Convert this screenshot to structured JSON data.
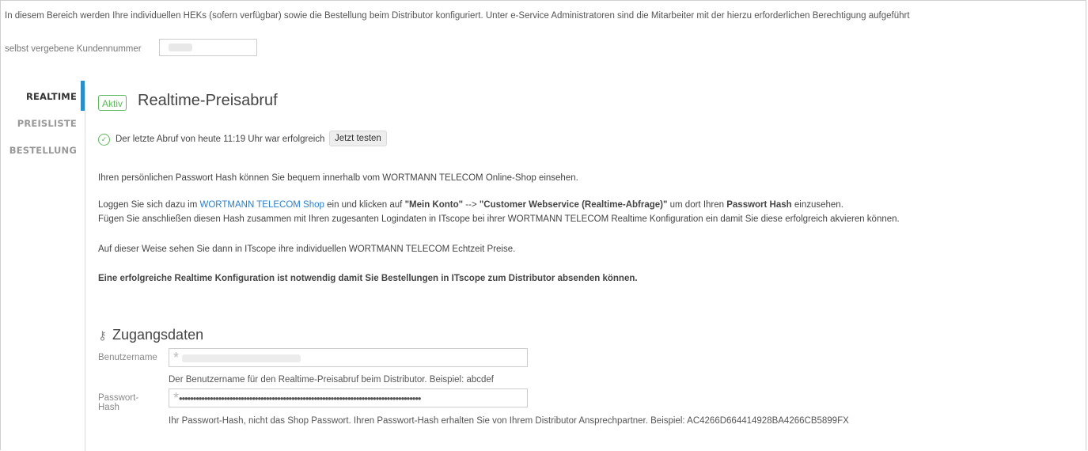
{
  "intro_text": "In diesem Bereich werden Ihre individuellen HEKs (sofern verfügbar) sowie die Bestellung beim Distributor konfiguriert. Unter e-Service Administratoren sind die Mitarbeiter mit der hierzu erforderlichen Berechtigung aufgeführt",
  "customer_number": {
    "label": "selbst vergebene Kundennummer",
    "value": ""
  },
  "nav": {
    "items": [
      {
        "label": "REALTIME",
        "active": true
      },
      {
        "label": "PREISLISTE",
        "active": false
      },
      {
        "label": "BESTELLUNG",
        "active": false
      }
    ],
    "accent_color": "#2a8fc9"
  },
  "realtime": {
    "badge": "Aktiv",
    "title": "Realtime-Preisabruf",
    "status_icon": "check-circle-icon",
    "status_text": "Der letzte Abruf von heute 11:19 Uhr war erfolgreich",
    "test_button": "Jetzt testen",
    "para1": "Ihren persönlichen Passwort Hash können Sie bequem innerhalb vom WORTMANN TELECOM Online-Shop einsehen.",
    "para2": {
      "t1": "Loggen Sie sich dazu im ",
      "link": "WORTMANN TELECOM Shop",
      "t2": " ein und klicken auf  ",
      "b1": "\"Mein Konto\"",
      "t3": " --> ",
      "b2": "\"Customer Webservice (Realtime-Abfrage)\"",
      "t4": " um dort Ihren ",
      "b3": "Passwort Hash",
      "t5": " einzusehen."
    },
    "para3": "Fügen Sie anschließen diesen Hash zusammen mit Ihren zugesanten Logindaten in ITscope bei ihrer WORTMANN TELECOM Realtime Konfiguration ein damit Sie diese erfolgreich akvieren können.",
    "para4": "Auf dieser Weise sehen Sie dann in ITscope ihre individuellen WORTMANN TELECOM Echtzeit Preise.",
    "para5": "Eine erfolgreiche Realtime Konfiguration ist notwendig damit Sie Bestellungen in ITscope zum Distributor absenden können."
  },
  "credentials": {
    "title": "Zugangsdaten",
    "title_icon": "key-icon",
    "username": {
      "label": "Benutzername",
      "value": "",
      "help": "Der Benutzername für den Realtime-Preisabruf beim Distributor. Beispiel: abcdef"
    },
    "password": {
      "label": "Passwort-Hash",
      "value": "••••••••••••••••••••••••••••••••••••••••••••••••••••••••••••••••••••••••••••••••••••••",
      "help": "Ihr Passwort-Hash, nicht das Shop Passwort. Ihren Passwort-Hash erhalten Sie von Ihrem Distributor Ansprechpartner. Beispiel: AC4266D664414928BA4266CB5899FX"
    },
    "required_marker": "*"
  },
  "colors": {
    "success": "#5cb85c",
    "link": "#2a7fc9"
  }
}
